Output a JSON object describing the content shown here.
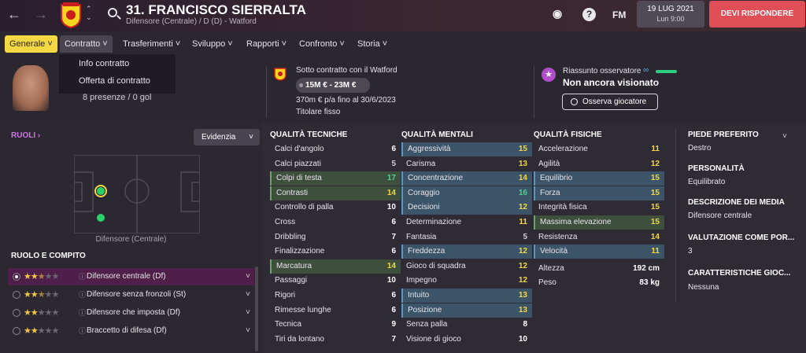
{
  "topbar": {
    "player_name": "31. FRANCISCO SIERRALTA",
    "player_sub": "Difensore (Centrale) / D (D) - Watford",
    "fm_label": "FM",
    "help_label": "?",
    "date": "19 LUG 2021",
    "time": "Lun 9:00",
    "respond_label": "DEVI RISPONDERE"
  },
  "tabs": [
    {
      "label": "Generale"
    },
    {
      "label": "Contratto"
    },
    {
      "label": "Trasferimenti"
    },
    {
      "label": "Sviluppo"
    },
    {
      "label": "Rapporti"
    },
    {
      "label": "Confronto"
    },
    {
      "label": "Storia"
    }
  ],
  "dropdown": [
    "Info contratto",
    "Offerta di contratto"
  ],
  "overview": {
    "appearances": "8 presenze / 0 gol",
    "contract_label": "Sotto contratto con il Watford",
    "value": "15M € - 23M €",
    "wage": "370m € p/a fino al 30/6/2023",
    "status": "Titolare fisso",
    "scout_label": "Riassunto osservatore",
    "scout_status": "Non ancora visionato",
    "observe_button": "Osserva giocatore"
  },
  "roles": {
    "title": "RUOLI",
    "highlight_button": "Evidenzia",
    "pitch_label": "Difensore (Centrale)",
    "role_header": "RUOLO E COMPITO",
    "items": [
      {
        "name": "Difensore centrale (Df)",
        "stars": 2.5
      },
      {
        "name": "Difensore senza fronzoli (St)",
        "stars": 2.5
      },
      {
        "name": "Difensore che imposta (Df)",
        "stars": 2
      },
      {
        "name": "Braccetto di difesa (Df)",
        "stars": 2
      }
    ]
  },
  "technical": {
    "title": "QUALITÀ TECNICHE",
    "items": [
      {
        "name": "Calci d'angolo",
        "value": "6"
      },
      {
        "name": "Calci piazzati",
        "value": "5"
      },
      {
        "name": "Colpi di testa",
        "value": "17"
      },
      {
        "name": "Contrasti",
        "value": "14"
      },
      {
        "name": "Controllo di palla",
        "value": "10"
      },
      {
        "name": "Cross",
        "value": "6"
      },
      {
        "name": "Dribbling",
        "value": "7"
      },
      {
        "name": "Finalizzazione",
        "value": "6"
      },
      {
        "name": "Marcatura",
        "value": "14"
      },
      {
        "name": "Passaggi",
        "value": "10"
      },
      {
        "name": "Rigori",
        "value": "6"
      },
      {
        "name": "Rimesse lunghe",
        "value": "6"
      },
      {
        "name": "Tecnica",
        "value": "9"
      },
      {
        "name": "Tiri da lontano",
        "value": "7"
      }
    ]
  },
  "mental": {
    "title": "QUALITÀ MENTALI",
    "items": [
      {
        "name": "Aggressività",
        "value": "15"
      },
      {
        "name": "Carisma",
        "value": "13"
      },
      {
        "name": "Concentrazione",
        "value": "14"
      },
      {
        "name": "Coraggio",
        "value": "16"
      },
      {
        "name": "Decisioni",
        "value": "12"
      },
      {
        "name": "Determinazione",
        "value": "11"
      },
      {
        "name": "Fantasia",
        "value": "5"
      },
      {
        "name": "Freddezza",
        "value": "12"
      },
      {
        "name": "Gioco di squadra",
        "value": "12"
      },
      {
        "name": "Impegno",
        "value": "12"
      },
      {
        "name": "Intuito",
        "value": "13"
      },
      {
        "name": "Posizione",
        "value": "13"
      },
      {
        "name": "Senza palla",
        "value": "8"
      },
      {
        "name": "Visione di gioco",
        "value": "10"
      }
    ]
  },
  "physical": {
    "title": "QUALITÀ FISICHE",
    "items": [
      {
        "name": "Accelerazione",
        "value": "11"
      },
      {
        "name": "Agilità",
        "value": "12"
      },
      {
        "name": "Equilibrio",
        "value": "15"
      },
      {
        "name": "Forza",
        "value": "15"
      },
      {
        "name": "Integrità fisica",
        "value": "15"
      },
      {
        "name": "Massima elevazione",
        "value": "15"
      },
      {
        "name": "Resistenza",
        "value": "14"
      },
      {
        "name": "Velocità",
        "value": "11"
      }
    ],
    "height_label": "Altezza",
    "height": "192 cm",
    "weight_label": "Peso",
    "weight": "83 kg"
  },
  "side": {
    "foot_label": "PIEDE PREFERITO",
    "foot": "Destro",
    "personality_label": "PERSONALITÀ",
    "personality": "Equilibrato",
    "media_label": "DESCRIZIONE DEI MEDIA",
    "media": "Difensore centrale",
    "rating_label": "VALUTAZIONE COME POR...",
    "rating": "3",
    "traits_label": "CARATTERISTICHE GIOC...",
    "traits": "Nessuna"
  }
}
